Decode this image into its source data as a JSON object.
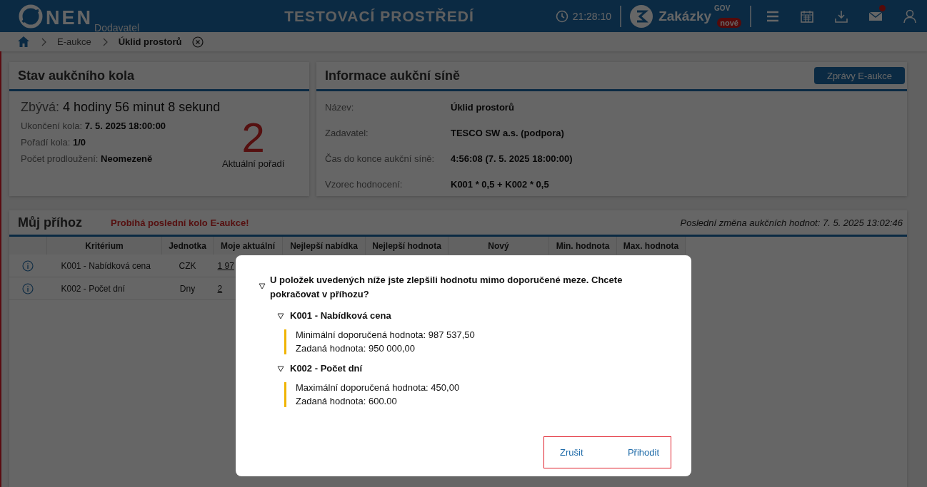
{
  "header": {
    "logo_text": "NEN",
    "logo_subtitle": "Dodavatel",
    "environment": "TESTOVACÍ PROSTŘEDÍ",
    "clock": "21:28:10",
    "brand": "Zakázky",
    "brand_sup": "GOV",
    "brand_badge": "nové",
    "mail_unread": true
  },
  "breadcrumbs": [
    "E-aukce",
    "Úklid prostorů"
  ],
  "round_status": {
    "title": "Stav aukčního kola",
    "remaining_label": "Zbývá:",
    "remaining_value": "4 hodiny 56 minut 8 sekund",
    "fields": [
      {
        "label": "Ukončení kola:",
        "value": "7. 5. 2025 18:00:00"
      },
      {
        "label": "Pořadí kola:",
        "value": "1/0"
      },
      {
        "label": "Počet prodloužení:",
        "value": "Neomezeně"
      }
    ],
    "rank": "2",
    "rank_label": "Aktuální pořadí"
  },
  "hall_info": {
    "title": "Informace aukční síně",
    "button": "Zprávy E-aukce",
    "fields": [
      {
        "label": "Název:",
        "value": "Úklid prostorů"
      },
      {
        "label": "Zadavatel:",
        "value": "TESCO SW a.s. (podpora)"
      },
      {
        "label": "Čas do konce aukční síně:",
        "value": "4:56:08 (7. 5. 2025 18:00:00)"
      },
      {
        "label": "Vzorec hodnocení:",
        "value": "K001 * 0,5 + K002 * 0,5"
      }
    ]
  },
  "bid": {
    "title": "Můj příhoz",
    "alert": "Probíhá poslední kolo E-aukce!",
    "last_change": "Poslední změna aukčních hodnot: 7. 5. 2025 13:02:46",
    "columns": [
      "Kritérium",
      "Jednotka",
      "Moje aktuální",
      "Nejlepší nabídka",
      "Nejlepší hodnota",
      "Nový",
      "Min. hodnota",
      "Max. hodnota"
    ],
    "rows": [
      {
        "criterion": "K001 - Nabídková cena",
        "unit": "CZK",
        "current": "1 97"
      },
      {
        "criterion": "K002 - Počet dní",
        "unit": "Dny",
        "current": "2"
      }
    ]
  },
  "dialog": {
    "question": "U položek uvedených níže jste zlepšili hodnotu mimo doporučené meze. Chcete pokračovat v příhozu?",
    "expanded": true,
    "groups": [
      {
        "title": "K001 - Nabídková cena",
        "expanded": true,
        "lines": [
          "Minimální doporučená hodnota: 987 537,50",
          "Zadaná hodnota: 950 000,00"
        ]
      },
      {
        "title": "K002 - Počet dní",
        "expanded": true,
        "lines": [
          "Maximální doporučená hodnota: 450,00",
          "Zadaná hodnota: 600.00"
        ]
      }
    ],
    "buttons": [
      "Zrušit",
      "Přihodit"
    ],
    "actions_highlighted": true
  }
}
